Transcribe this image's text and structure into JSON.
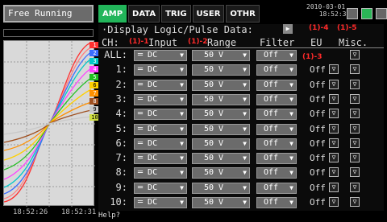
{
  "left_header": "Free Running",
  "time_left": "18:52:26",
  "time_right": "18:52:31",
  "channels_tags": [
    "1",
    "2",
    "3",
    "4",
    "5",
    "6",
    "7",
    "8",
    "9",
    "10"
  ],
  "tabs": [
    {
      "label": "AMP",
      "active": true
    },
    {
      "label": "DATA",
      "active": false
    },
    {
      "label": "TRIG",
      "active": false
    },
    {
      "label": "USER",
      "active": false
    },
    {
      "label": "OTHR",
      "active": false
    }
  ],
  "datetime": {
    "date": "2010-03-01",
    "time": "18:52:31"
  },
  "display_label": "·Display Logic/Pulse Data:",
  "header": {
    "ch": "CH:",
    "input": "Input",
    "range": "Range",
    "filter": "Filter",
    "eu": "EU",
    "misc": "Misc."
  },
  "annotations": {
    "a1": "(1)-1",
    "a2": "(1)-2",
    "a3": "(1)-3",
    "a4": "(1)-4",
    "a5": "(1)-5"
  },
  "rows": [
    {
      "ch": "ALL:",
      "input": "DC",
      "range": "50 V",
      "filter": "Off",
      "eu": "",
      "misc": "▽"
    },
    {
      "ch": "1:",
      "input": "DC",
      "range": "50 V",
      "filter": "Off",
      "eu": "Off",
      "misc": "▽"
    },
    {
      "ch": "2:",
      "input": "DC",
      "range": "50 V",
      "filter": "Off",
      "eu": "Off",
      "misc": "▽"
    },
    {
      "ch": "3:",
      "input": "DC",
      "range": "50 V",
      "filter": "Off",
      "eu": "Off",
      "misc": "▽"
    },
    {
      "ch": "4:",
      "input": "DC",
      "range": "50 V",
      "filter": "Off",
      "eu": "Off",
      "misc": "▽"
    },
    {
      "ch": "5:",
      "input": "DC",
      "range": "50 V",
      "filter": "Off",
      "eu": "Off",
      "misc": "▽"
    },
    {
      "ch": "6:",
      "input": "DC",
      "range": "50 V",
      "filter": "Off",
      "eu": "Off",
      "misc": "▽"
    },
    {
      "ch": "7:",
      "input": "DC",
      "range": "50 V",
      "filter": "Off",
      "eu": "Off",
      "misc": "▽"
    },
    {
      "ch": "8:",
      "input": "DC",
      "range": "50 V",
      "filter": "Off",
      "eu": "Off",
      "misc": "▽"
    },
    {
      "ch": "9:",
      "input": "DC",
      "range": "50 V",
      "filter": "Off",
      "eu": "Off",
      "misc": "▽"
    },
    {
      "ch": "10:",
      "input": "DC",
      "range": "50 V",
      "filter": "Off",
      "eu": "Off",
      "misc": "▽"
    }
  ],
  "status": "Help?",
  "colors": {
    "tab_active": "#22b55a",
    "annotation": "#ff2a2a",
    "panel": "#6b6b6b"
  }
}
